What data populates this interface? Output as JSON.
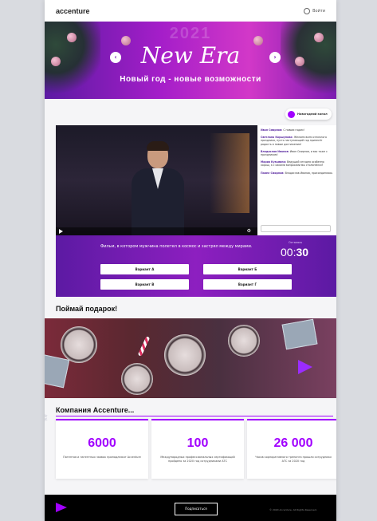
{
  "header": {
    "logo": "accenture",
    "login": "Войти"
  },
  "hero": {
    "year": "2021",
    "title": "New Era",
    "subtitle": "Новый год - новые возможности",
    "prev_label": "‹",
    "next_label": "›"
  },
  "chat_button": {
    "label": "Новогодний канал"
  },
  "chat": {
    "messages": [
      {
        "author": "Иван Смирнов:",
        "text": "С новым годом!"
      },
      {
        "author": "Светлана Коршунова:",
        "text": "Желаем всем отличного праздника, пусть наступающий год принесёт радость и новые достижения!"
      },
      {
        "author": "Владислав Иванов:",
        "text": "Иван Смирнов, и вас тоже с праздником!"
      },
      {
        "author": "Мария Кузьмина:",
        "text": "Ведущий сегодня особенно хорош, а с какими вопросами мы столкнёмся?"
      },
      {
        "author": "Павел Смирнов:",
        "text": "Владислав Иванов, присоединяюсь"
      }
    ]
  },
  "quiz": {
    "question": "Фильм, в котором мужчина полетел в космос и застрял между мирами.",
    "timer_label": "Осталось",
    "timer_prefix": "00:",
    "timer_value": "30",
    "options": [
      "Вариант А",
      "Вариант Б",
      "Вариант В",
      "Вариант Г"
    ]
  },
  "gift": {
    "title": "Поймай подарок!"
  },
  "company": {
    "title": "Компания Accenture...",
    "stats": [
      {
        "value": "6000",
        "desc": "Патентов и патентных заявок принадлежат Accenture"
      },
      {
        "value": "100",
        "desc": "Международных профессиональных сертификаций пройдено за 2020 год сотрудниками АТС"
      },
      {
        "value": "26 000",
        "desc": "Часов корпоративного тренинга прошли сотрудники АТС за 2020 год"
      }
    ]
  },
  "footer": {
    "button": "Подписаться",
    "copyright": "© 2020 Accenture. All Rights Reserved."
  },
  "colors": {
    "accent": "#a100ff",
    "purple_dark": "#5c1aa3"
  },
  "icons": {
    "login": "user-circle-icon",
    "chat": "chat-bubble-icon",
    "play": "play-icon",
    "settings": "gear-icon"
  }
}
